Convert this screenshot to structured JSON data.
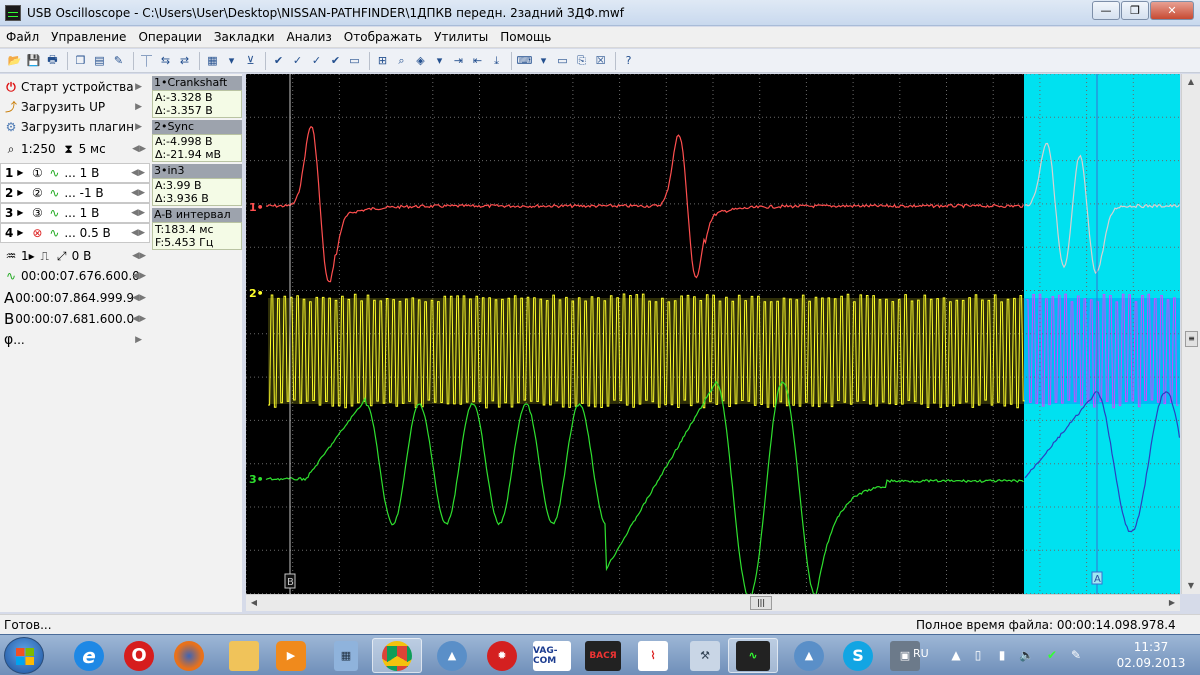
{
  "window": {
    "title": "USB Oscilloscope - C:\\Users\\User\\Desktop\\NISSAN-PATHFINDER\\1ДПКВ передн. 2задний ЗДФ.mwf",
    "min_glyph": "—",
    "max_glyph": "❐",
    "close_glyph": "✕"
  },
  "menu": [
    "Файл",
    "Управление",
    "Операции",
    "Закладки",
    "Анализ",
    "Отображать",
    "Утилиты",
    "Помощь"
  ],
  "left_panel": {
    "start_device": "Старт устройства",
    "load_up": "Загрузить UP",
    "load_plugin": "Загрузить плагин",
    "zoom": "1:250",
    "timebase": "5 мс",
    "channels": [
      {
        "label": "1",
        "value": "... 1 В"
      },
      {
        "label": "2",
        "value": "... -1 В"
      },
      {
        "label": "3",
        "value": "... 1 В"
      },
      {
        "label": "4",
        "value": "... 0.5 В"
      }
    ],
    "trigger": "0 В",
    "trigger_time": "00:00:07.676.600.0",
    "cursor_a": "00:00:07.864.999.9",
    "cursor_b": "00:00:07.681.600.0",
    "phi": "..."
  },
  "info_panel": [
    {
      "head": "1•Crankshaft",
      "line1": "A:-3.328 В",
      "line2": "Δ:-3.357 В"
    },
    {
      "head": "2•Sync",
      "line1": "A:-4.998 В",
      "line2": "Δ:-21.94 мВ"
    },
    {
      "head": "3•in3",
      "line1": "A:3.99 В",
      "line2": "Δ:3.936 В"
    },
    {
      "head": "A-B интервал",
      "line1": "T:183.4 мс",
      "line2": "F:5.453 Гц"
    }
  ],
  "scope": {
    "background": "#000000",
    "highlight_region_color": "#00e1f0",
    "grid_color": "#6a6a6a",
    "channel_markers": [
      "1•",
      "2•",
      "3•"
    ],
    "cursor_b_label": "B",
    "cursor_a_label": "A",
    "colors": {
      "ch1": "#ff4f4f",
      "ch2": "#ffff2b",
      "ch3": "#2fe02f",
      "ch1_region": "#d8d0d0",
      "ch2_region": "#d048ff",
      "ch2_region_fill": "#0077ff",
      "ch3_region": "#2b3fc0"
    }
  },
  "status": {
    "left": "Готов...",
    "right": "Полное время файла: 00:00:14.098.978.4"
  },
  "taskbar": {
    "apps": [
      "ie",
      "opera",
      "firefox",
      "explorer",
      "media",
      "calculator",
      "chrome",
      "app-triangle",
      "app-red",
      "VAG-COM",
      "ВАСЯ",
      "app-graph",
      "app-tools",
      "oscilloscope",
      "app-triangle-2",
      "skype",
      "app-film"
    ],
    "vag_label": "VAG-COM",
    "vasya_label": "ВАСЯ",
    "lang": "RU",
    "time": "11:37",
    "date": "02.09.2013"
  }
}
